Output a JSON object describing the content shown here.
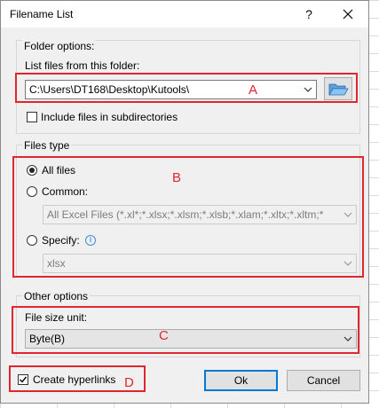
{
  "window": {
    "title": "Filename List",
    "help_glyph": "?",
    "close_icon": "close-icon"
  },
  "folder_options": {
    "group_label": "Folder options:",
    "list_label": "List files from this folder:",
    "path_value": "C:\\Users\\DT168\\Desktop\\Kutools\\",
    "browse_icon": "folder-open-icon",
    "include_subdirs_label": "Include files in subdirectories",
    "include_subdirs_checked": false
  },
  "files_type": {
    "group_label": "Files type",
    "all_files_label": "All files",
    "all_files_selected": true,
    "common_label": "Common:",
    "common_value": "All Excel Files (*.xl*;*.xlsx;*.xlsm;*.xlsb;*.xlam;*.xltx;*.xltm;*",
    "specify_label": "Specify:",
    "specify_value": "xlsx"
  },
  "other_options": {
    "group_label": "Other options",
    "size_unit_label": "File size unit:",
    "size_unit_value": "Byte(B)"
  },
  "footer": {
    "create_hyperlinks_label": "Create hyperlinks",
    "create_hyperlinks_checked": true,
    "ok_label": "Ok",
    "cancel_label": "Cancel"
  },
  "annotations": {
    "a": "A",
    "b": "B",
    "c": "C",
    "d": "D",
    "color": "#e0262f"
  }
}
